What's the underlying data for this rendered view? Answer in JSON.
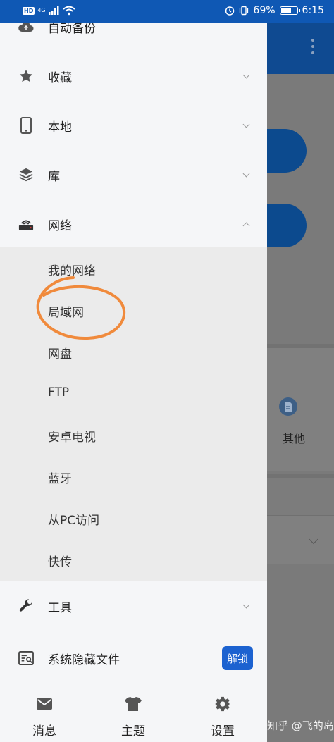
{
  "status_bar": {
    "hd": "HD",
    "network": "4G",
    "battery_percent": "69%",
    "battery_level": 0.69,
    "time": "6:15"
  },
  "drawer": {
    "items": [
      {
        "label": "自动备份",
        "icon": "cloud-backup-icon"
      },
      {
        "label": "收藏",
        "icon": "star-icon"
      },
      {
        "label": "本地",
        "icon": "phone-icon"
      },
      {
        "label": "库",
        "icon": "layers-icon"
      },
      {
        "label": "网络",
        "icon": "router-icon"
      }
    ],
    "network_subitems": [
      "我的网络",
      "局域网",
      "网盘",
      "FTP",
      "安卓电视",
      "蓝牙",
      "从PC访问",
      "快传"
    ],
    "tools": {
      "label": "工具",
      "icon": "wrench-icon"
    },
    "hidden_files": {
      "label": "系统隐藏文件",
      "icon": "hidden-files-icon",
      "button": "解锁"
    }
  },
  "bottom_nav": [
    {
      "label": "消息",
      "icon": "mail-icon"
    },
    {
      "label": "主题",
      "icon": "shirt-icon"
    },
    {
      "label": "设置",
      "icon": "gear-icon"
    }
  ],
  "background": {
    "other_label": "其他",
    "watermark": "知乎 @飞的岛"
  },
  "colors": {
    "accent": "#1c62d0",
    "status_bar": "#0f58b4",
    "annotation_circle": "#f08a3c"
  }
}
